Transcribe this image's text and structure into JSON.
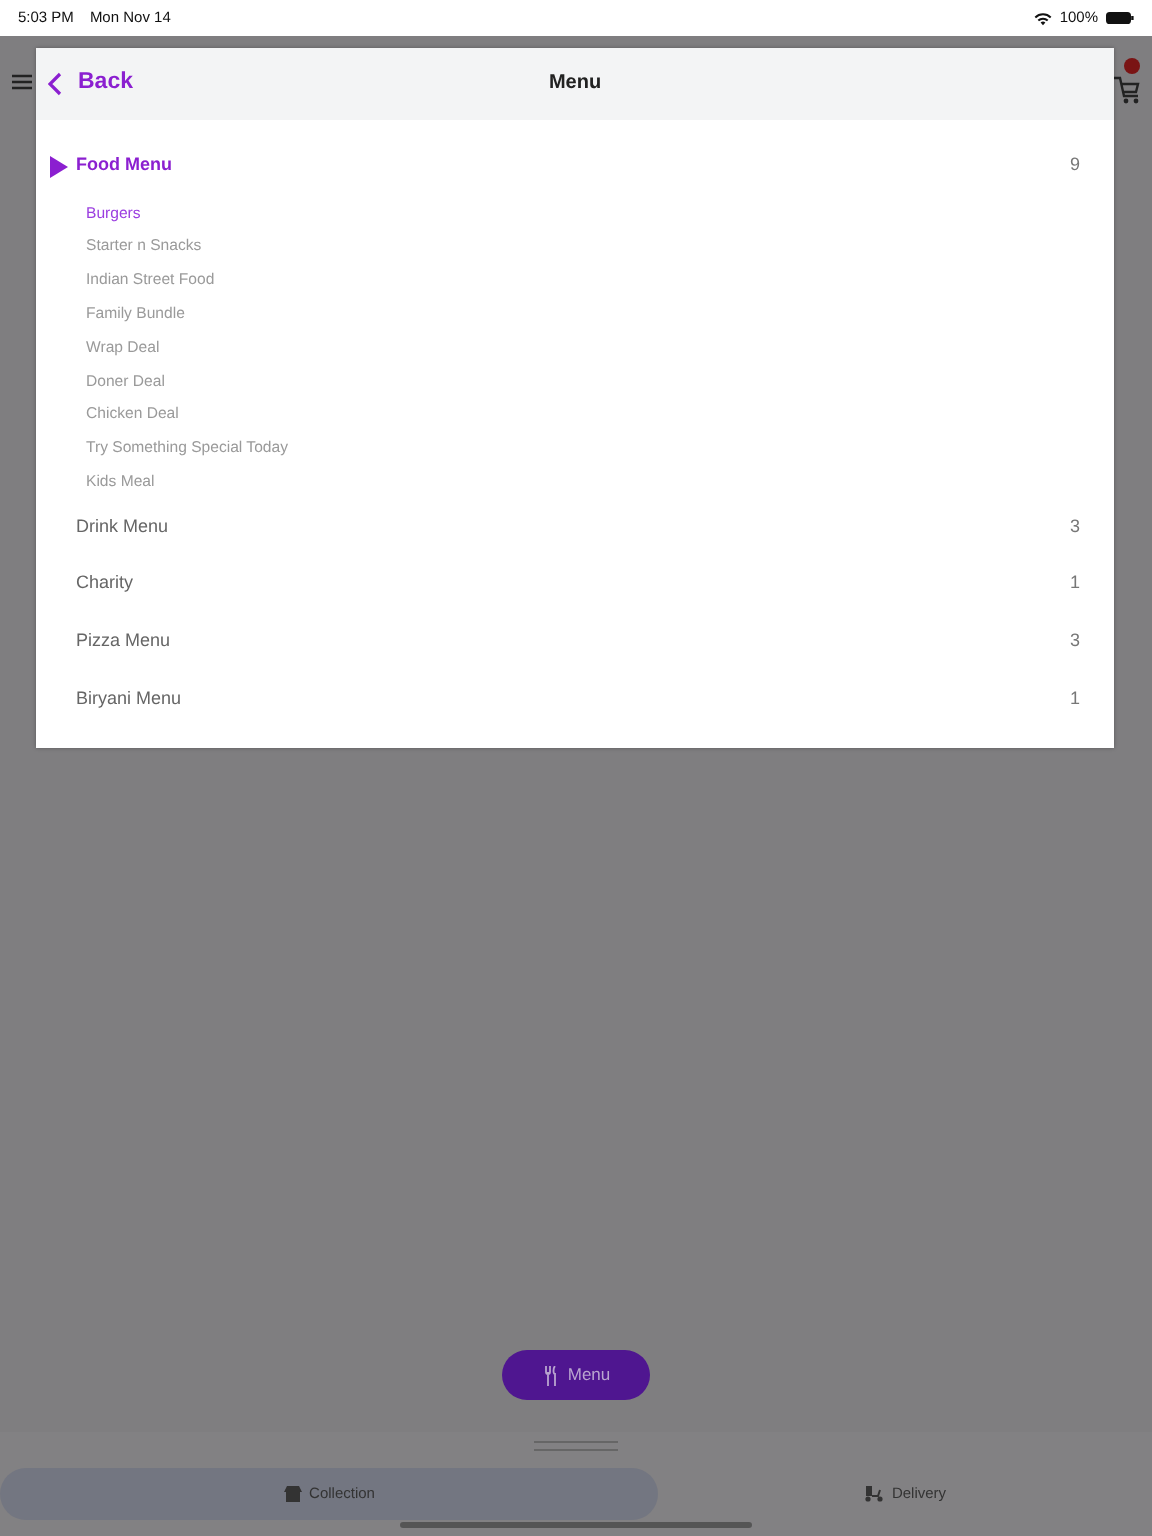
{
  "status_bar": {
    "time": "5:03 PM",
    "date": "Mon Nov 14",
    "battery": "100%"
  },
  "header": {
    "back": "Back",
    "title": "Menu"
  },
  "categories": [
    {
      "label": "Food Menu",
      "count": "9",
      "selected": true,
      "expanded": true,
      "children": [
        {
          "label": "Burgers",
          "selected": true
        },
        {
          "label": "Starter n Snacks",
          "selected": false
        },
        {
          "label": "Indian Street Food",
          "selected": false
        },
        {
          "label": "Family Bundle",
          "selected": false
        },
        {
          "label": "Wrap Deal",
          "selected": false
        },
        {
          "label": "Doner Deal",
          "selected": false
        },
        {
          "label": "Chicken Deal",
          "selected": false
        },
        {
          "label": "Try Something Special Today",
          "selected": false
        },
        {
          "label": "Kids Meal",
          "selected": false
        }
      ]
    },
    {
      "label": "Drink Menu",
      "count": "3",
      "selected": false,
      "expanded": false
    },
    {
      "label": "Charity",
      "count": "1",
      "selected": false,
      "expanded": false
    },
    {
      "label": "Pizza Menu",
      "count": "3",
      "selected": false,
      "expanded": false
    },
    {
      "label": "Biryani Menu",
      "count": "1",
      "selected": false,
      "expanded": false
    }
  ],
  "menu_button": "Menu",
  "order_tabs": [
    {
      "label": "Collection",
      "selected": true
    },
    {
      "label": "Delivery",
      "selected": false
    }
  ]
}
